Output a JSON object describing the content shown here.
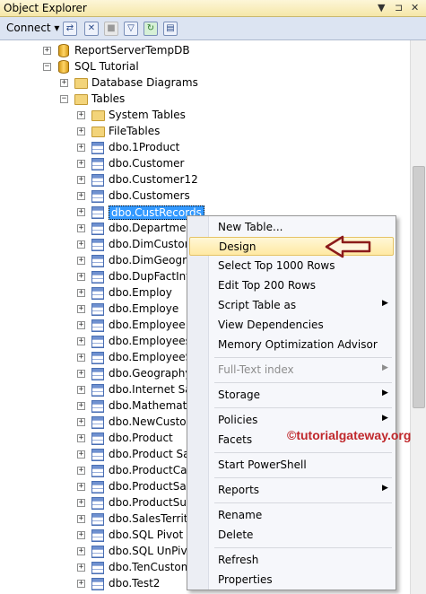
{
  "window": {
    "title": "Object Explorer",
    "pin_glyph": "▼",
    "autohide_glyph": "⊐",
    "close_glyph": "✕"
  },
  "toolbar": {
    "connect_label": "Connect ▾"
  },
  "tree": {
    "db_report": "ReportServerTempDB",
    "db_sql": "SQL Tutorial",
    "folder_diagrams": "Database Diagrams",
    "folder_tables": "Tables",
    "folder_system": "System Tables",
    "folder_filetables": "FileTables",
    "tables": [
      "dbo.1Product",
      "dbo.Customer",
      "dbo.Customer12",
      "dbo.Customers",
      "dbo.CustRecords",
      "dbo.Department",
      "dbo.DimCustom",
      "dbo.DimGeogra",
      "dbo.DupFactInte",
      "dbo.Employ",
      "dbo.Employe",
      "dbo.Employee",
      "dbo.Employees",
      "dbo.EmployeeSD",
      "dbo.Geography",
      "dbo.Internet Sale",
      "dbo.Mathematic",
      "dbo.NewCuston",
      "dbo.Product",
      "dbo.Product Sal",
      "dbo.ProductCat",
      "dbo.ProductSale",
      "dbo.ProductSub",
      "dbo.SalesTerrito",
      "dbo.SQL Pivot S",
      "dbo.SQL UnPivo",
      "dbo.TenCustom",
      "dbo.Test2"
    ]
  },
  "context_menu": {
    "new_table": "New Table...",
    "design": "Design",
    "select_top": "Select Top 1000 Rows",
    "edit_top": "Edit Top 200 Rows",
    "script_table": "Script Table as",
    "view_deps": "View Dependencies",
    "memory_opt": "Memory Optimization Advisor",
    "fulltext": "Full-Text index",
    "storage": "Storage",
    "policies": "Policies",
    "facets": "Facets",
    "powershell": "Start PowerShell",
    "reports": "Reports",
    "rename": "Rename",
    "delete": "Delete",
    "refresh": "Refresh",
    "properties": "Properties",
    "submenu_arrow": "▶"
  },
  "watermark": "©tutorialgateway.org",
  "colors": {
    "selection": "#3399ff",
    "annotation_arrow": "#8b1a1a",
    "watermark": "#c0282c"
  }
}
